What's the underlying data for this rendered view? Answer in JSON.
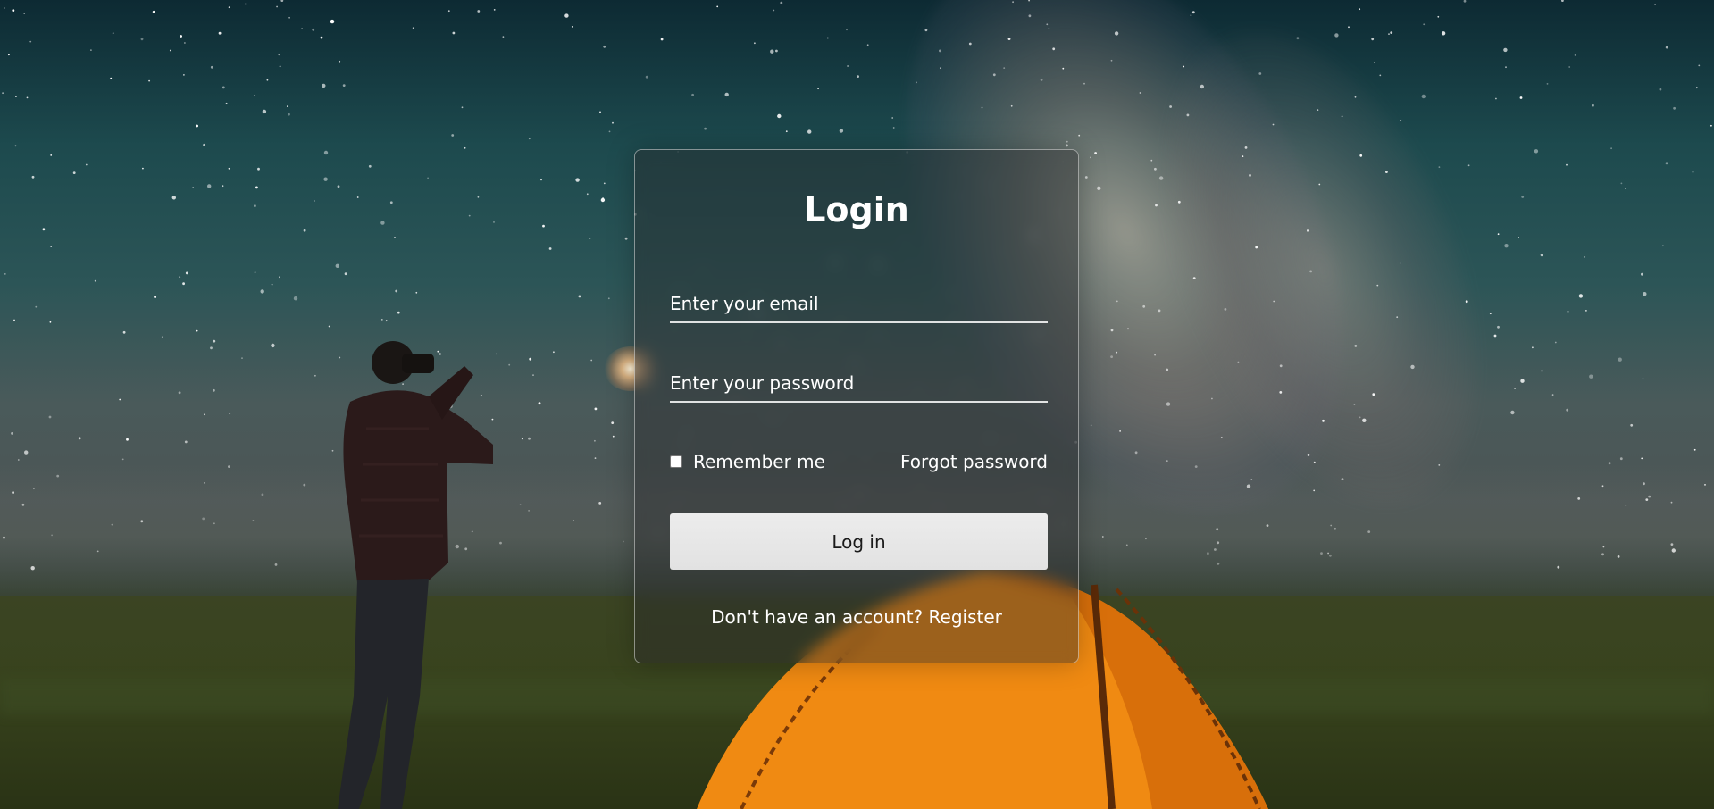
{
  "login": {
    "title": "Login",
    "email_placeholder": "Enter your email",
    "password_placeholder": "Enter your password",
    "remember_label": "Remember me",
    "remember_checked": false,
    "forgot_label": "Forgot password",
    "submit_label": "Log in",
    "register_prompt": "Don't have an account?",
    "register_label": "Register"
  },
  "colors": {
    "card_border": "#ffffff",
    "button_bg": "#e6e6e6",
    "text": "#ffffff",
    "tent_orange": "#f08a12"
  },
  "icons": {
    "checkbox": "checkbox-icon"
  }
}
